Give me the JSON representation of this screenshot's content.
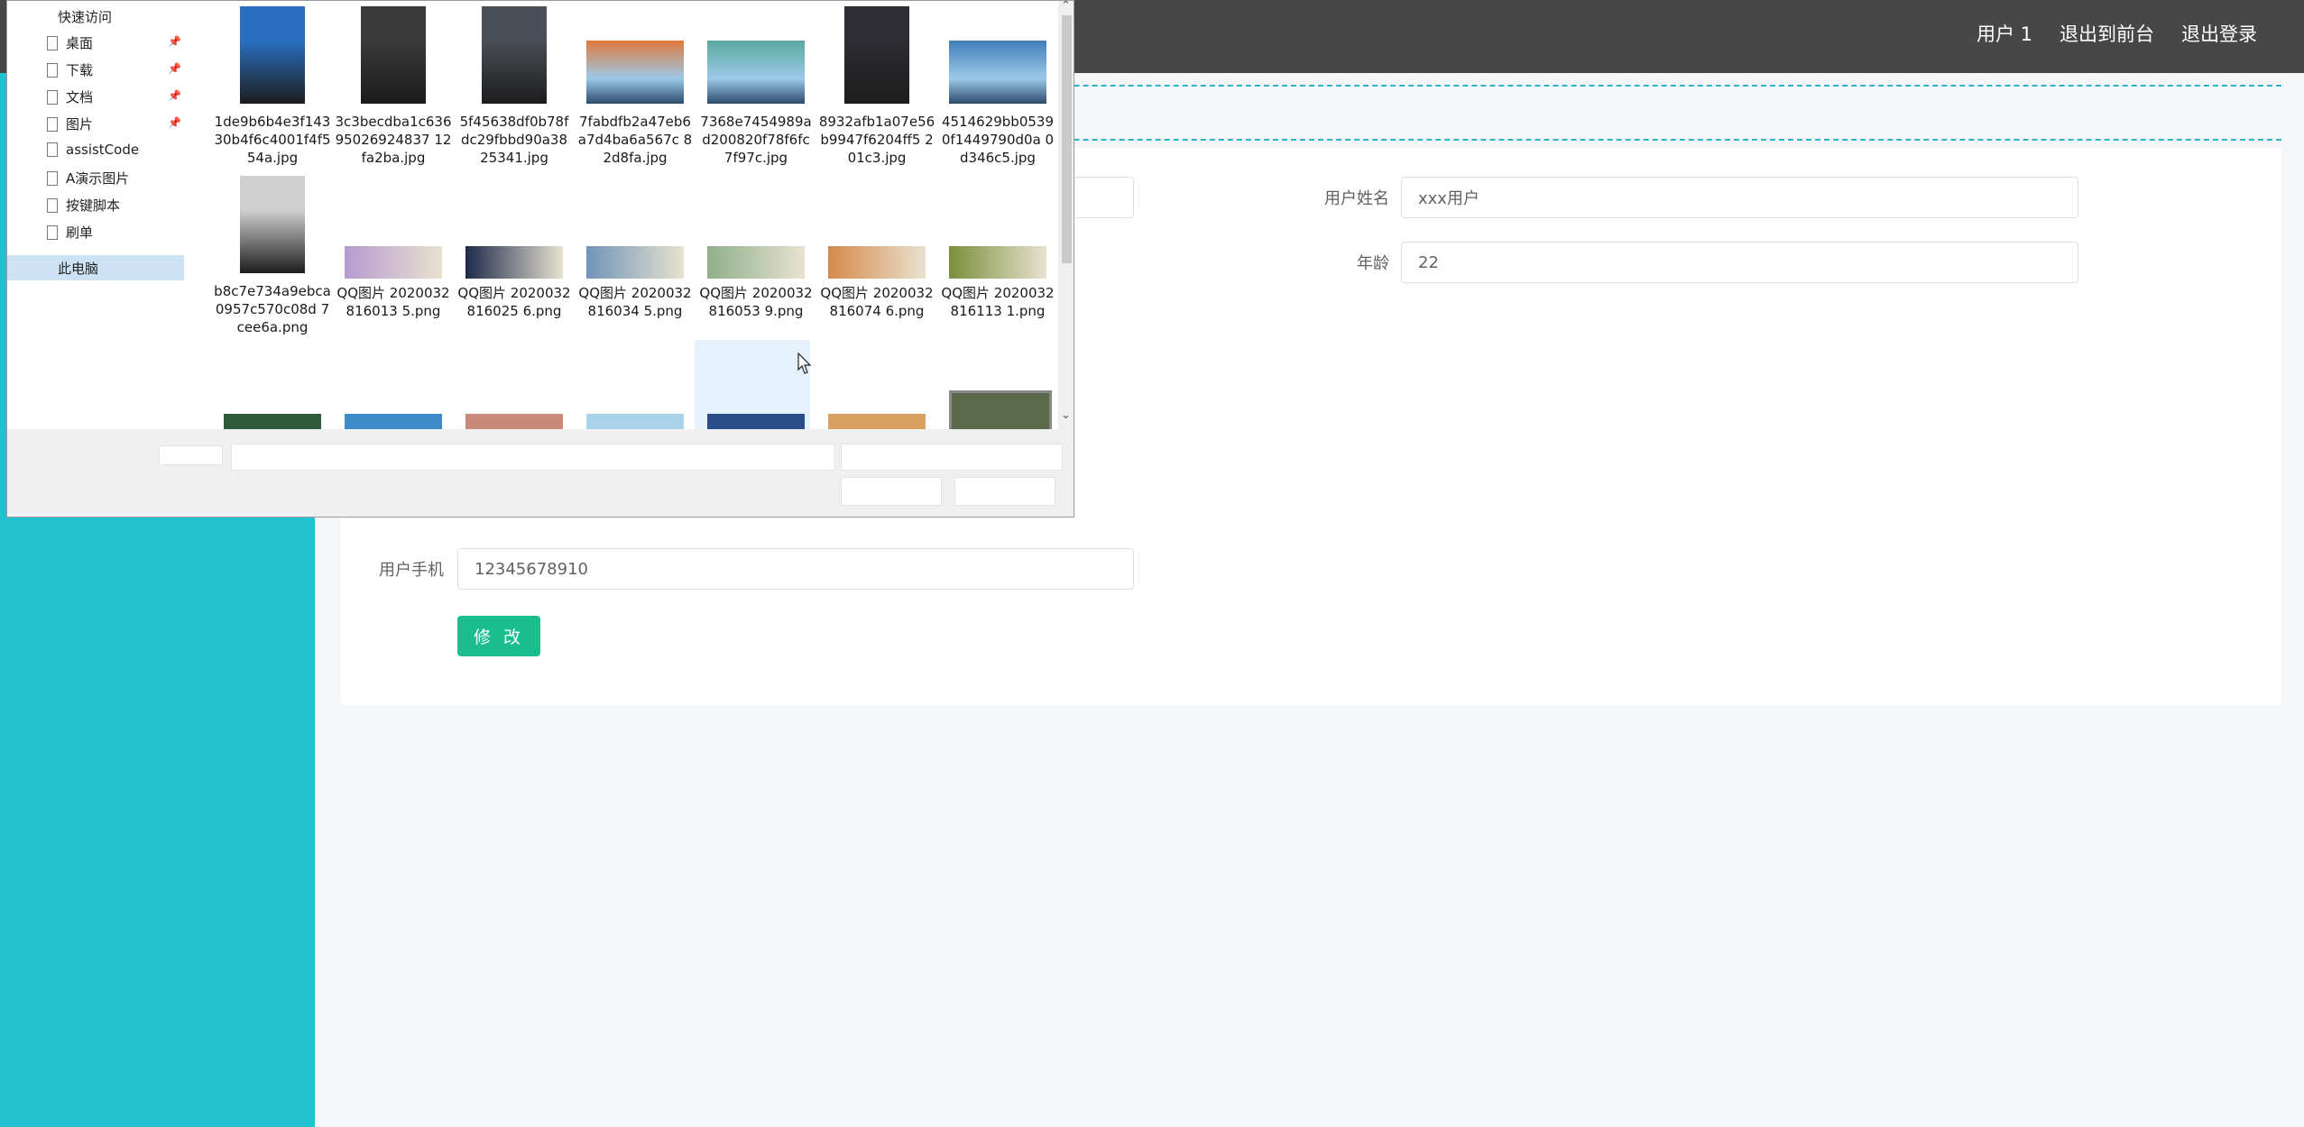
{
  "header": {
    "user_label": "用户 1",
    "to_front_label": "退出到前台",
    "logout_label": "退出登录"
  },
  "form": {
    "name_label": "用户姓名",
    "name_value": "xxx用户",
    "age_label": "年龄",
    "age_value": "22",
    "phone_label": "用户手机",
    "phone_value": "12345678910",
    "submit_label": "修 改"
  },
  "dialog": {
    "nav": {
      "quick_access": "快速访问",
      "items": [
        {
          "label": "桌面",
          "pinned": true
        },
        {
          "label": "下载",
          "pinned": true
        },
        {
          "label": "文档",
          "pinned": true
        },
        {
          "label": "图片",
          "pinned": true
        },
        {
          "label": "assistCode",
          "pinned": false
        },
        {
          "label": "A演示图片",
          "pinned": false
        },
        {
          "label": "按键脚本",
          "pinned": false
        },
        {
          "label": "刷单",
          "pinned": false
        }
      ],
      "this_pc": "此电脑"
    },
    "files": [
      {
        "name": "1de9b6b4e3f14330b4f6c4001f4f554a.jpg",
        "kind": "portrait",
        "color": "#2a6fbf"
      },
      {
        "name": "3c3becdba1c63695026924837 12fa2ba.jpg",
        "kind": "portrait",
        "color": "#3a3a3a"
      },
      {
        "name": "5f45638df0b78fdc29fbbd90a38 25341.jpg",
        "kind": "portrait",
        "color": "#4a4e56"
      },
      {
        "name": "7fabdfb2a47eb6a7d4ba6a567c 82d8fa.jpg",
        "kind": "landscape",
        "color": "#e07a3c"
      },
      {
        "name": "7368e7454989ad200820f78f6fc 7f97c.jpg",
        "kind": "landscape",
        "color": "#5aa8a0"
      },
      {
        "name": "8932afb1a07e56b9947f6204ff5 201c3.jpg",
        "kind": "portrait",
        "color": "#2d2d33"
      },
      {
        "name": "4514629bb05390f1449790d0a 0d346c5.jpg",
        "kind": "landscape",
        "color": "#3f7fb8"
      },
      {
        "name": "b8c7e734a9ebca0957c570c08d 7cee6a.png",
        "kind": "portrait",
        "color": "#cfcfcf"
      },
      {
        "name": "QQ图片 2020032816013 5.png",
        "kind": "banner",
        "color": "#b79ad0"
      },
      {
        "name": "QQ图片 2020032816025 6.png",
        "kind": "banner",
        "color": "#1e2a4a"
      },
      {
        "name": "QQ图片 2020032816034 5.png",
        "kind": "banner",
        "color": "#6f95b7"
      },
      {
        "name": "QQ图片 2020032816053 9.png",
        "kind": "banner",
        "color": "#8fb08a"
      },
      {
        "name": "QQ图片 2020032816074 6.png",
        "kind": "banner",
        "color": "#d68a4a"
      },
      {
        "name": "QQ图片 2020032816113 1.png",
        "kind": "banner",
        "color": "#7a8f3a"
      }
    ],
    "partial_colors": [
      "#2f5a3a",
      "#3d8bc9",
      "#c98a7a",
      "#a9d3e8",
      "#2a4d8a",
      "#d9a060",
      "#5a6a4a"
    ]
  }
}
